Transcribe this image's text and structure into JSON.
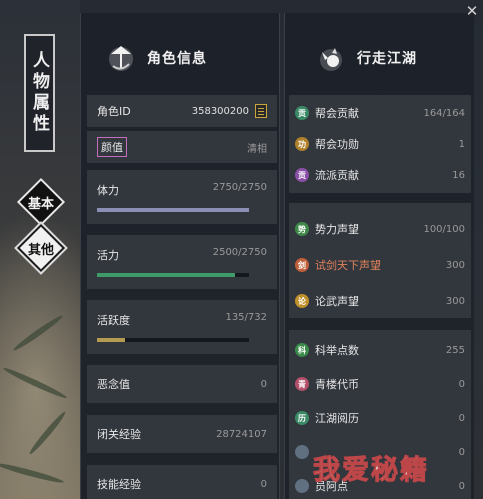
{
  "window": {
    "close_symbol": "✕"
  },
  "sidebar": {
    "title": "人物属性",
    "tabs": [
      {
        "label": "基本",
        "active": true
      },
      {
        "label": "其他",
        "active": false
      }
    ]
  },
  "left_panel": {
    "title": "角色信息",
    "emblem_icon": "umbrella-ink-icon",
    "rows": [
      {
        "key": "角色ID",
        "value": "358300200"
      },
      {
        "key": "颜值",
        "value": "清相"
      },
      {
        "key": "体力",
        "value": "2750/2750",
        "fill": 1.0,
        "bar_color": "#8b8fb6"
      },
      {
        "key": "活力",
        "value": "2500/2750",
        "fill": 0.909,
        "bar_color": "#3f9a6a"
      },
      {
        "key": "活跃度",
        "value": "135/732",
        "fill": 0.184,
        "bar_color": "#b59a52"
      },
      {
        "key": "恶念值",
        "value": "0"
      },
      {
        "key": "闭关经验",
        "value": "28724107"
      },
      {
        "key": "技能经验",
        "value": "0"
      }
    ]
  },
  "right_panel": {
    "title": "行走江湖",
    "emblem_icon": "ink-swirl-icon",
    "groups": [
      {
        "items": [
          {
            "icon": "guild-contribution-icon",
            "icon_text": "贡",
            "icon_color": "#3a8a66",
            "key": "帮会贡献",
            "value": "164/164"
          },
          {
            "icon": "guild-merit-icon",
            "icon_text": "功",
            "icon_color": "#b0802a",
            "key": "帮会功勋",
            "value": "1"
          },
          {
            "icon": "school-contribution-icon",
            "icon_text": "贡",
            "icon_color": "#8a4fa6",
            "key": "流派贡献",
            "value": "16"
          }
        ]
      },
      {
        "items": [
          {
            "icon": "faction-reputation-icon",
            "icon_text": "势",
            "icon_color": "#3f8a4a",
            "key": "势力声望",
            "value": "100/100"
          },
          {
            "icon": "sword-trial-icon",
            "icon_text": "剑",
            "icon_color": "#c0603a",
            "key": "试剑天下声望",
            "value": "300",
            "highlight": true
          },
          {
            "icon": "martial-debate-icon",
            "icon_text": "论",
            "icon_color": "#c0902a",
            "key": "论武声望",
            "value": "300"
          }
        ]
      },
      {
        "items": [
          {
            "icon": "exam-points-icon",
            "icon_text": "科",
            "icon_color": "#3a8a4a",
            "key": "科举点数",
            "value": "255"
          },
          {
            "icon": "qinglou-coin-icon",
            "icon_text": "青",
            "icon_color": "#b0506a",
            "key": "青楼代币",
            "value": "0"
          },
          {
            "icon": "jianghu-experience-icon",
            "icon_text": "历",
            "icon_color": "#3a8a66",
            "key": "江湖阅历",
            "value": "0"
          },
          {
            "icon": "misc-icon-1",
            "icon_text": "",
            "icon_color": "#607080",
            "key": "",
            "value": "0"
          },
          {
            "icon": "misc-icon-2",
            "icon_text": "",
            "icon_color": "#607080",
            "key": "员阿点",
            "value": "0"
          }
        ]
      }
    ]
  },
  "watermark": "我爱秘籍"
}
